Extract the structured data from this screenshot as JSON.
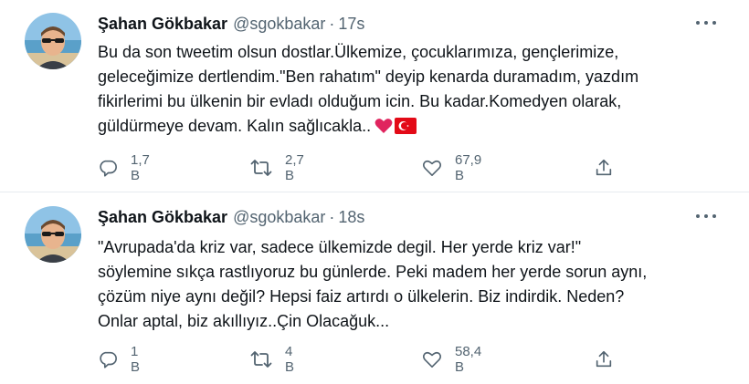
{
  "tweets": [
    {
      "author": {
        "name": "Şahan Gökbakar",
        "handle": "@sgokbakar"
      },
      "time": "17s",
      "separator": "·",
      "lines": [
        "Bu da son tweetim olsun dostlar.Ülkemize, çocuklarımıza, gençlerimize,",
        "geleceğimize dertlendim.\"Ben rahatım\" deyip kenarda duramadım, yazdım",
        "fikirlerimi  bu ülkenin bir evladı olduğum icin. Bu kadar.Komedyen olarak,",
        "güldürmeye devam. Kalın sağlıcakla.."
      ],
      "emojis": [
        "red-heart",
        "turkey-flag"
      ],
      "stats": {
        "replies": "1,7 B",
        "retweets": "2,7 B",
        "likes": "67,9 B"
      }
    },
    {
      "author": {
        "name": "Şahan Gökbakar",
        "handle": "@sgokbakar"
      },
      "time": "18s",
      "separator": "·",
      "lines": [
        "\"Avrupada'da kriz var, sadece ülkemizde degil. Her yerde kriz var!\"",
        "söylemine sıkça rastlıyoruz bu günlerde. Peki madem her yerde sorun aynı,",
        "çözüm niye aynı değil? Hepsi faiz artırdı o ülkelerin. Biz indirdik. Neden?",
        "Onlar aptal, biz akıllıyız..Çin Olacağuk..."
      ],
      "stats": {
        "replies": "1 B",
        "retweets": "4 B",
        "likes": "58,4 B"
      }
    }
  ],
  "icons": {
    "reply": "reply-icon",
    "retweet": "retweet-icon",
    "like": "like-icon",
    "share": "share-icon",
    "more": "more-options-icon"
  },
  "colors": {
    "text": "#0f1419",
    "secondary": "#536471",
    "divider": "#e6ecf0",
    "heart": "#e0245e",
    "flag": "#e30a17"
  }
}
